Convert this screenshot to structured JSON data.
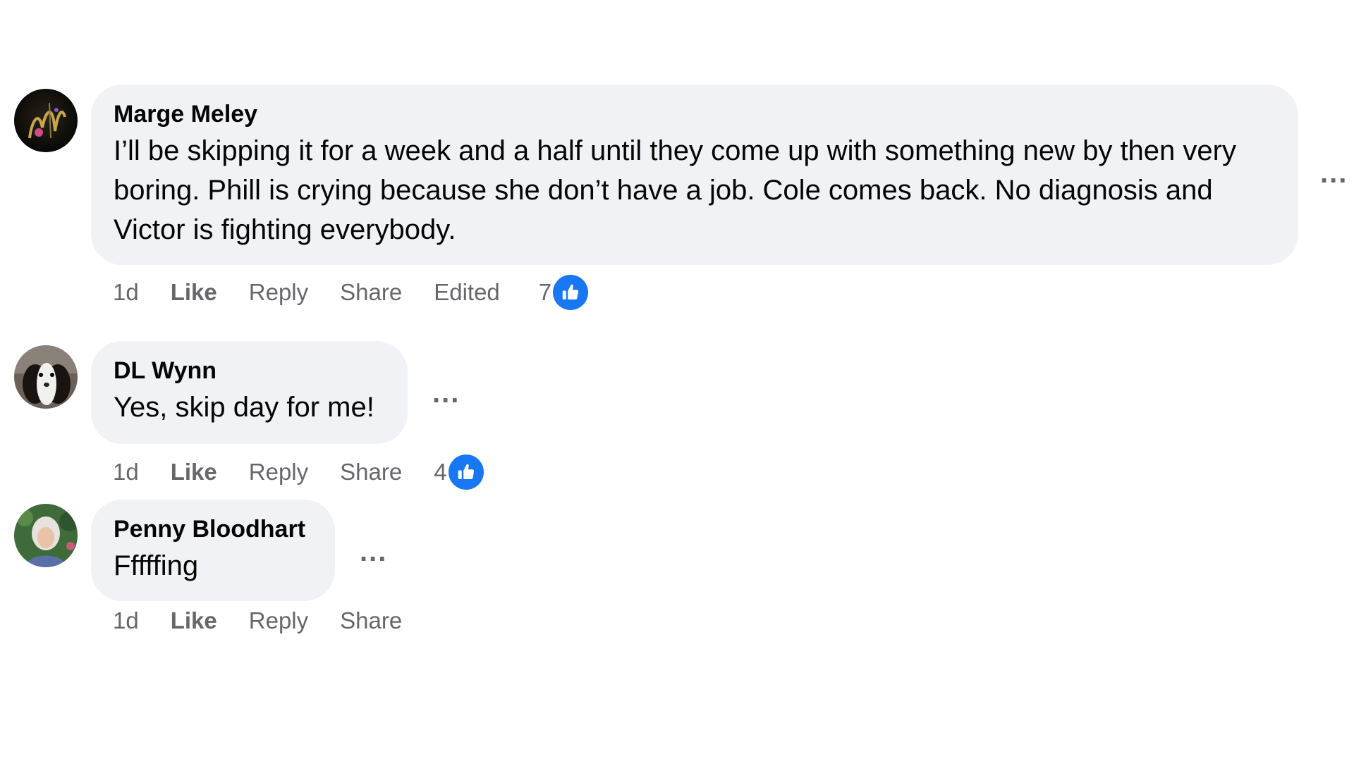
{
  "comments": [
    {
      "author": "Marge Meley",
      "text": "I’ll be skipping it for a week and a half until they come up with something new by then very boring. Phill is crying because she don’t have a job. Cole comes back. No diagnosis and Victor is fighting everybody.",
      "time": "1d",
      "like_label": "Like",
      "reply_label": "Reply",
      "share_label": "Share",
      "edited_label": "Edited",
      "reaction_count": "7",
      "avatar_icon": "decorative-letter-m-avatar"
    },
    {
      "author": "DL Wynn",
      "text": "Yes, skip day for me!",
      "time": "1d",
      "like_label": "Like",
      "reply_label": "Reply",
      "share_label": "Share",
      "reaction_count": "4",
      "avatar_icon": "dog-photo-avatar"
    },
    {
      "author": "Penny Bloodhart",
      "text": "Fffffing",
      "time": "1d",
      "like_label": "Like",
      "reply_label": "Reply",
      "share_label": "Share",
      "avatar_icon": "person-photo-avatar"
    }
  ],
  "more_label": "...",
  "colors": {
    "bubble": "#f0f2f5",
    "secondary_text": "#65676b",
    "like_blue": "#1877f2"
  }
}
